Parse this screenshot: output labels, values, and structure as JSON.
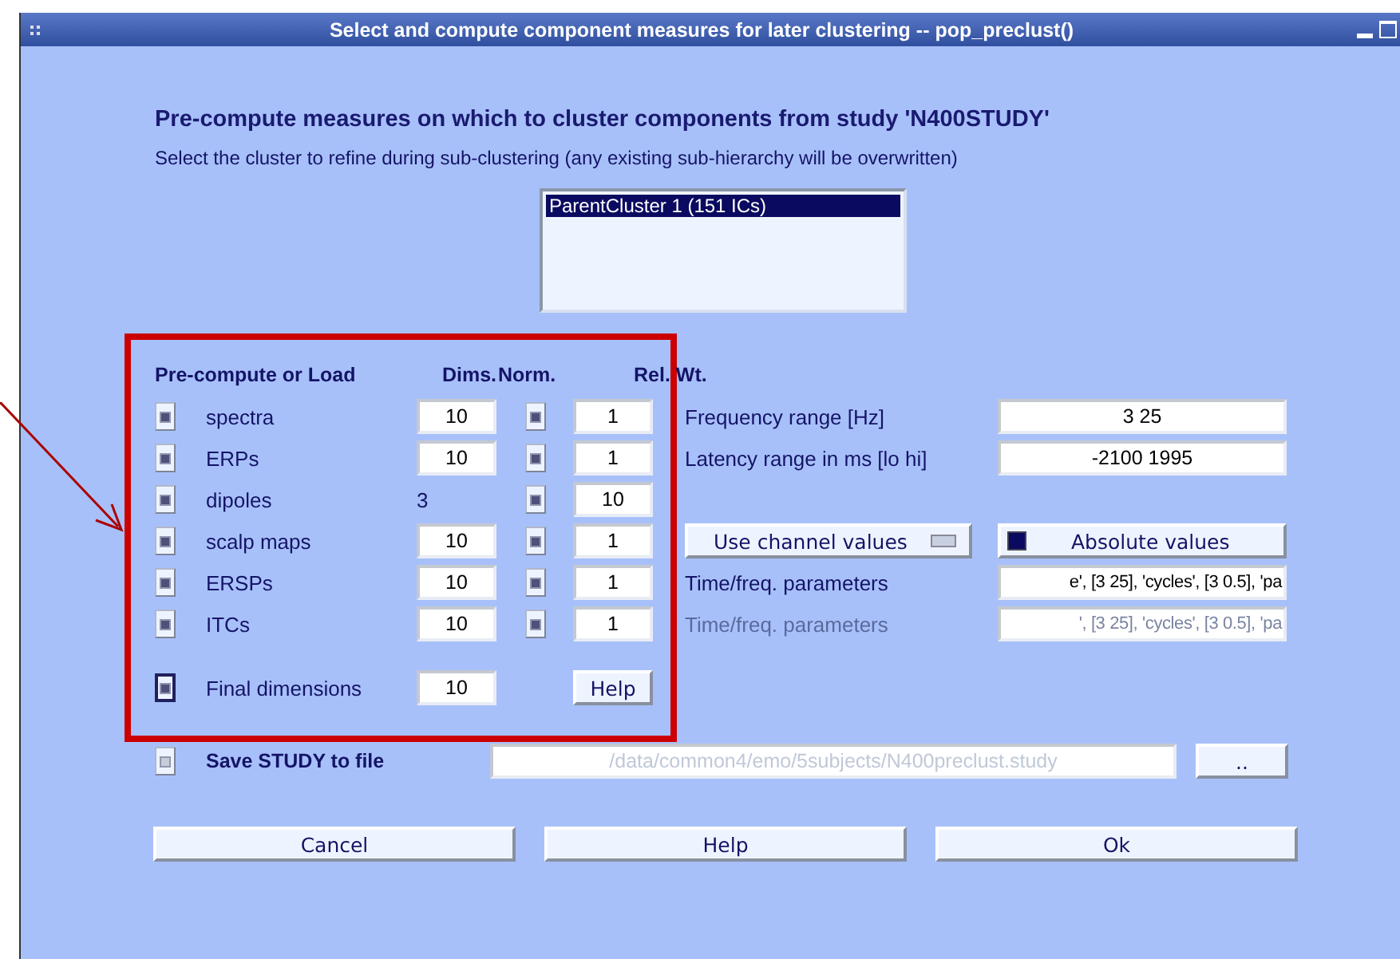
{
  "window": {
    "title": "Select and compute component measures for later clustering -- pop_preclust()"
  },
  "heading": "Pre-compute measures on which to cluster components from study 'N400STUDY'",
  "instruction": "Select the cluster to refine during sub-clustering (any existing sub-hierarchy will be overwritten)",
  "cluster_list": {
    "items": [
      {
        "label": "ParentCluster 1 (151 ICs)",
        "selected": true
      }
    ]
  },
  "measures": {
    "columns": [
      "Pre-compute or Load",
      "Dims.",
      "Norm.",
      "Rel. Wt."
    ],
    "rows": [
      {
        "name": "spectra",
        "checked": true,
        "dims_editable": true,
        "dims": "10",
        "norm": true,
        "weight": "1"
      },
      {
        "name": "ERPs",
        "checked": true,
        "dims_editable": true,
        "dims": "10",
        "norm": true,
        "weight": "1"
      },
      {
        "name": "dipoles",
        "checked": true,
        "dims_editable": false,
        "dims": "3",
        "norm": true,
        "weight": "10"
      },
      {
        "name": "scalp maps",
        "checked": true,
        "dims_editable": true,
        "dims": "10",
        "norm": true,
        "weight": "1"
      },
      {
        "name": "ERSPs",
        "checked": true,
        "dims_editable": true,
        "dims": "10",
        "norm": true,
        "weight": "1"
      },
      {
        "name": "ITCs",
        "checked": true,
        "dims_editable": true,
        "dims": "10",
        "norm": true,
        "weight": "1"
      }
    ],
    "final": {
      "label": "Final dimensions",
      "checked": true,
      "value": "10",
      "help": "Help"
    }
  },
  "ranges": [
    {
      "label": "Frequency range [Hz]",
      "value": "3  25"
    },
    {
      "label": "Latency range in ms [lo hi]",
      "value": "-2100  1995"
    }
  ],
  "value_options": {
    "channel_button": "Use channel values",
    "absolute": {
      "label": "Absolute values",
      "checked": true
    }
  },
  "time_freq": [
    {
      "label": "Time/freq. parameters",
      "value": "e', [3 25], 'cycles', [3 0.5], 'pa",
      "disabled": false
    },
    {
      "label": "Time/freq. parameters",
      "value": "', [3 25], 'cycles', [3 0.5], 'pa",
      "disabled": true
    }
  ],
  "save": {
    "label": "Save STUDY to file",
    "checked": false,
    "path": "/data/common4/emo/5subjects/N400preclust.study",
    "path_disabled": true,
    "browse": ".."
  },
  "buttons": [
    "Cancel",
    "Help",
    "Ok"
  ]
}
